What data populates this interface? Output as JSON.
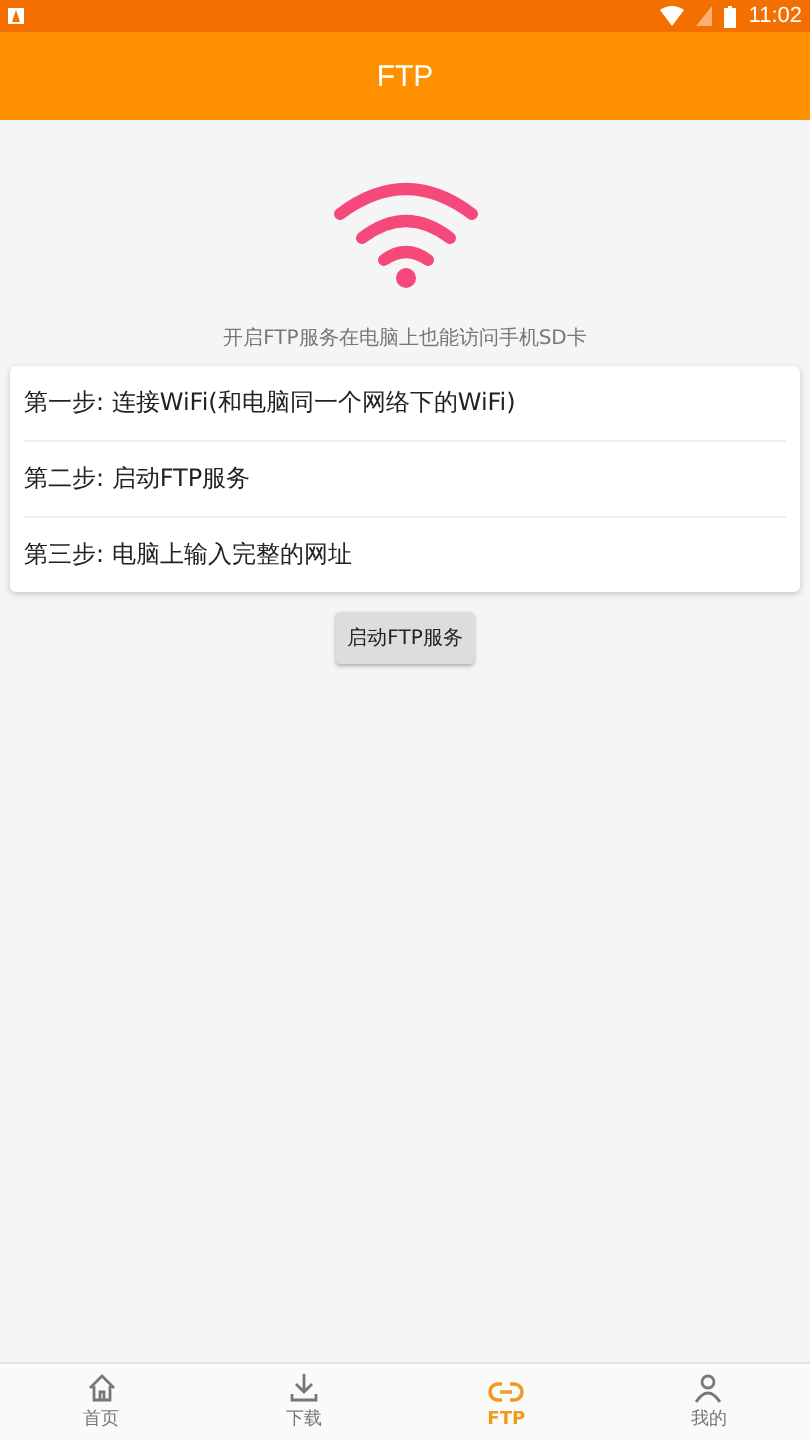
{
  "status_bar": {
    "time": "11:02"
  },
  "app_bar": {
    "title": "FTP"
  },
  "hint": "开启FTP服务在电脑上也能访问手机SD卡",
  "steps": [
    "第一步: 连接WiFi(和电脑同一个网络下的WiFi)",
    "第二步: 启动FTP服务",
    "第三步: 电脑上输入完整的网址"
  ],
  "start_button": "启动FTP服务",
  "bottom_nav": [
    {
      "label": "首页",
      "kind": "home",
      "selected": false
    },
    {
      "label": "下载",
      "kind": "download",
      "selected": false
    },
    {
      "label": "FTP",
      "kind": "link",
      "selected": true
    },
    {
      "label": "我的",
      "kind": "person",
      "selected": false
    }
  ]
}
